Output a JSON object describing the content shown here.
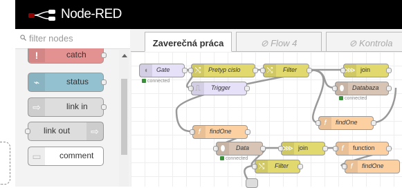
{
  "app": {
    "title": "Node-RED"
  },
  "palette": {
    "filter_placeholder": "filter nodes",
    "nodes": [
      {
        "label": "catch",
        "color": "#e49191"
      },
      {
        "label": "status",
        "color": "#94c1d0"
      },
      {
        "label": "link in",
        "color": "#dddddd"
      },
      {
        "label": "link out",
        "color": "#dddddd"
      },
      {
        "label": "comment",
        "color": "#ffffff"
      }
    ]
  },
  "tabs": [
    {
      "label": "Zaverečná práca",
      "active": true
    },
    {
      "label": "Flow 4",
      "disabled": true
    },
    {
      "label": "Kontrola",
      "disabled": true
    }
  ],
  "flow": {
    "nodes": {
      "gate": "Gate",
      "pretyp": "Pretyp cislo",
      "filter1": "Filter",
      "trigger": "Trigger",
      "join1": "join",
      "databaza": "Databaza",
      "findone1": "findOne",
      "findone2": "findOne",
      "data": "Data",
      "join2": "join",
      "function": "function",
      "findone3": "findOne",
      "filter2": "Filter"
    },
    "status_connected": "connected",
    "colors": {
      "yellow": "#e2d96e",
      "lavender": "#e6e0f8",
      "mauve": "#c9b8cf",
      "orange": "#fdd0a2",
      "tan": "#d8c4b4"
    }
  }
}
